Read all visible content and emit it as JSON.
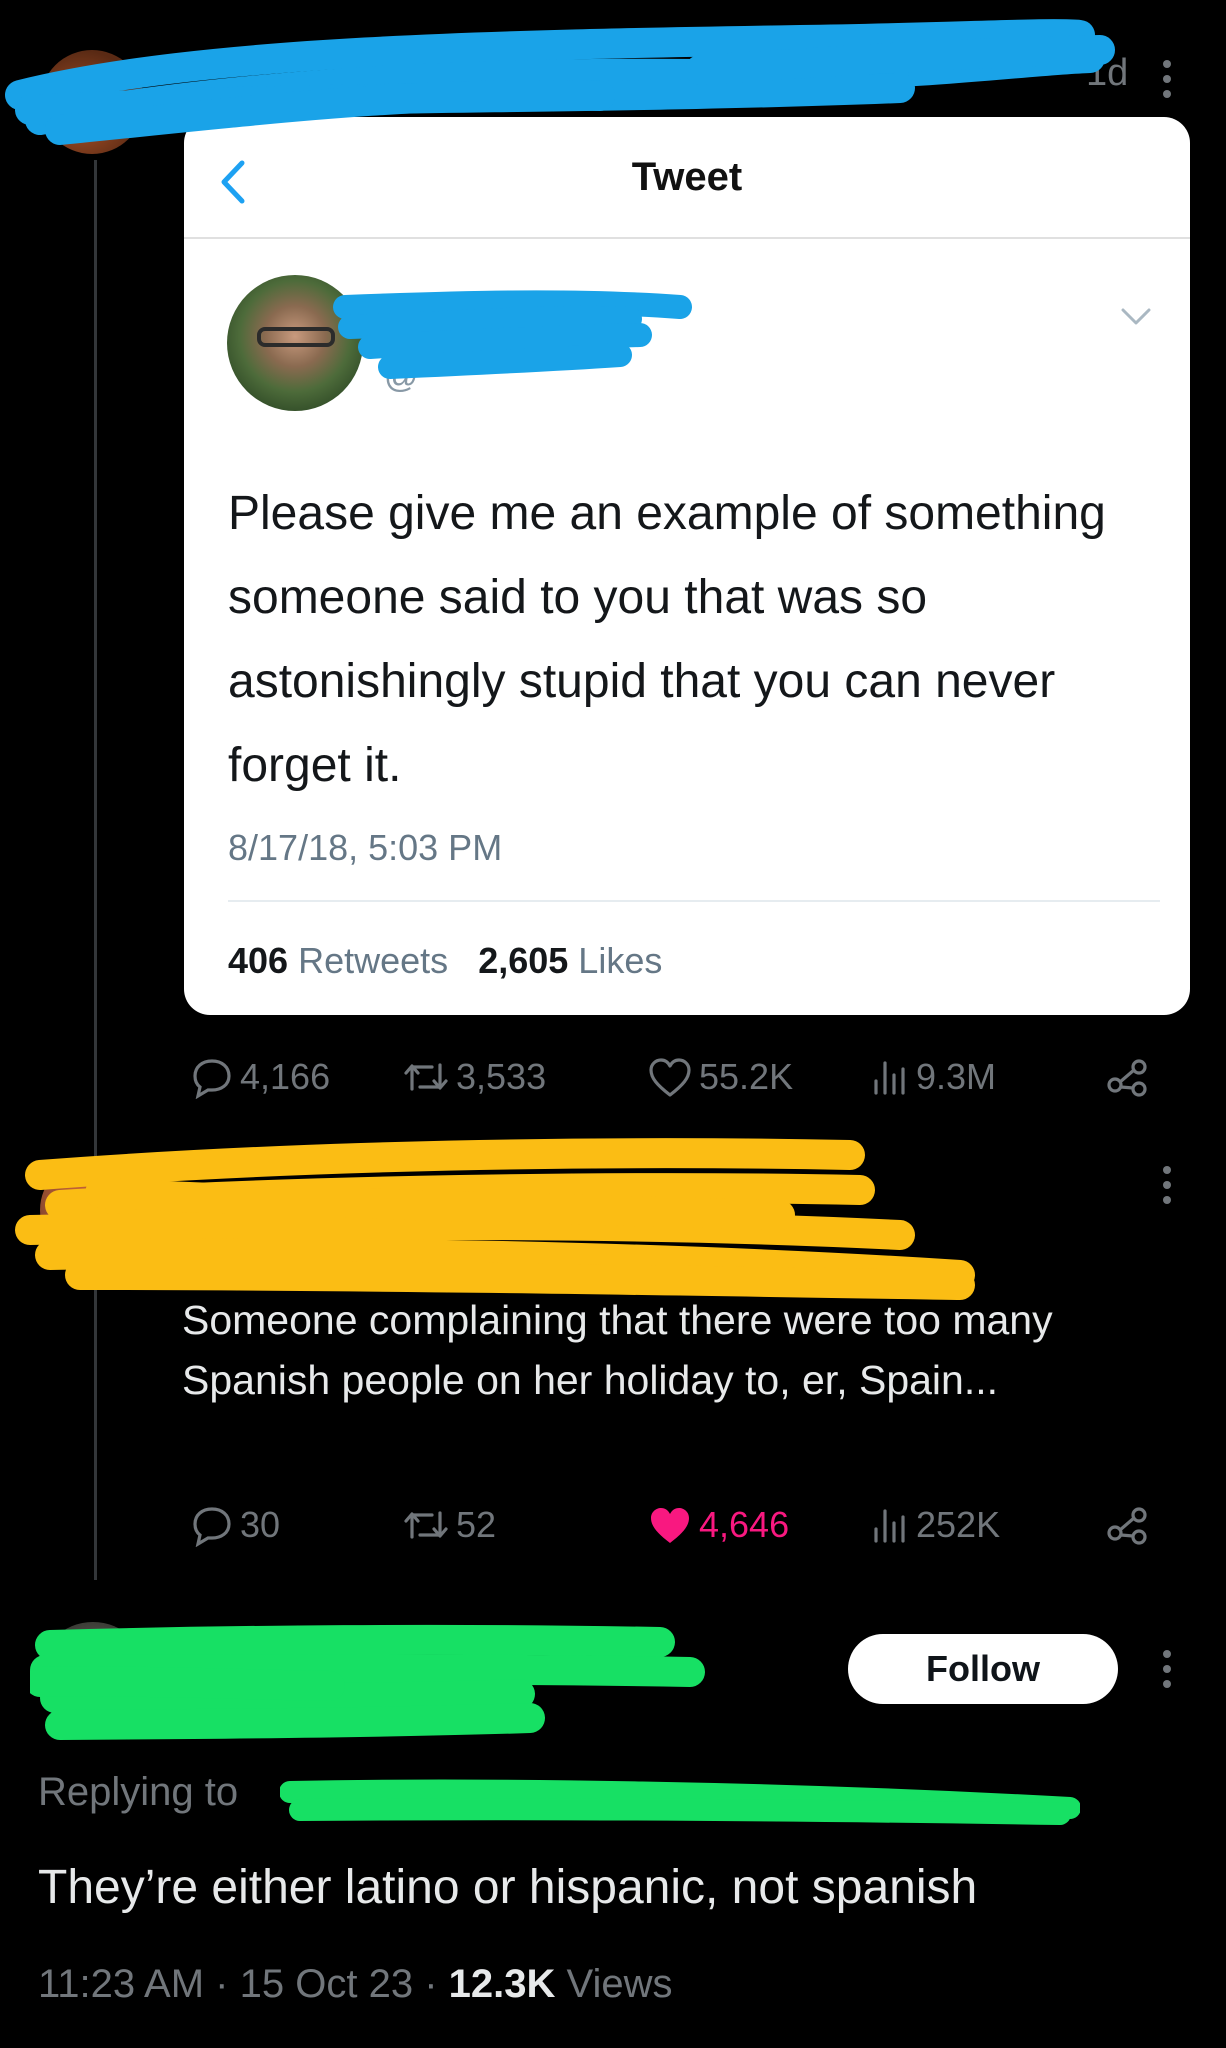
{
  "top_meta": {
    "time_suffix": "1d"
  },
  "quoted_card": {
    "title": "Tweet",
    "handle_prefix": "@",
    "text": "Please give me an example of something someone said to you that was so astonishingly stupid that you can never forget it.",
    "date": "8/17/18, 5:03 PM",
    "retweets_count": "406",
    "retweets_label": "Retweets",
    "likes_count": "2,605",
    "likes_label": "Likes"
  },
  "tweet1_actions": {
    "replies": "4,166",
    "reposts": "3,533",
    "likes": "55.2K",
    "views": "9.3M"
  },
  "tweet2": {
    "text": "Someone complaining that there were too many Spanish people on her holiday to, er, Spain...",
    "replies": "30",
    "reposts": "52",
    "likes": "4,646",
    "views": "252K"
  },
  "tweet3": {
    "follow_label": "Follow",
    "replying_label": "Replying to",
    "text": "They’re either latino or hispanic, not spanish",
    "time": "11:23 AM",
    "date": "15 Oct 23",
    "views_count": "12.3K",
    "views_label": "Views"
  },
  "colors": {
    "background": "#000000",
    "like_active": "#f91880",
    "muted": "#71767b",
    "censor_blue": "#1aa3e8",
    "censor_yellow": "#fbbd14",
    "censor_green": "#17e064"
  }
}
